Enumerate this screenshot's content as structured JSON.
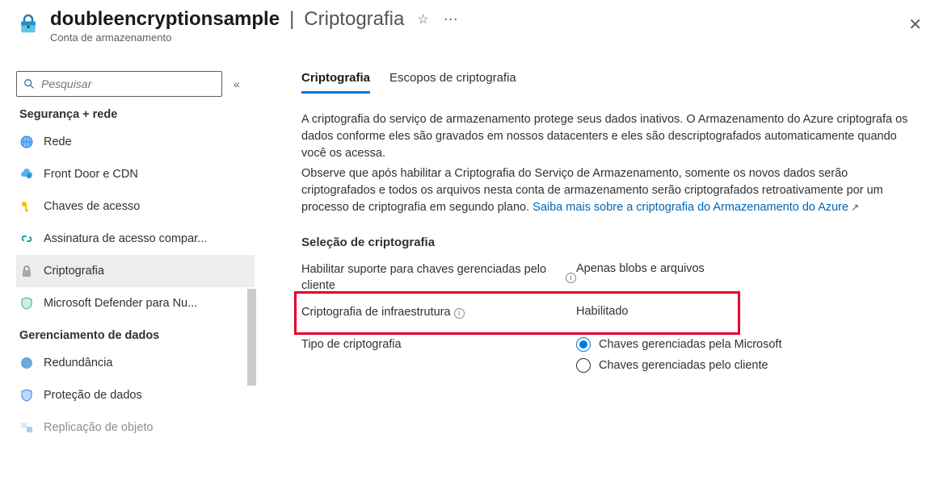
{
  "header": {
    "resource_name": "doubleencryptionsample",
    "separator": "|",
    "blade_name": "Criptografia",
    "subtitle": "Conta de armazenamento"
  },
  "sidebar": {
    "search_placeholder": "Pesquisar",
    "section_security": "Segurança + rede",
    "section_data": "Gerenciamento de dados",
    "items_security": [
      {
        "label": "Rede"
      },
      {
        "label": "Front Door e CDN"
      },
      {
        "label": "Chaves de acesso"
      },
      {
        "label": "Assinatura de acesso compar..."
      },
      {
        "label": "Criptografia",
        "active": true
      },
      {
        "label": "Microsoft Defender para Nu..."
      }
    ],
    "items_data": [
      {
        "label": "Redundância"
      },
      {
        "label": "Proteção de dados"
      },
      {
        "label": "Replicação de objeto"
      }
    ]
  },
  "tabs": [
    {
      "label": "Criptografia",
      "active": true
    },
    {
      "label": "Escopos de criptografia"
    }
  ],
  "content": {
    "para1": "A criptografia do serviço de armazenamento protege seus dados inativos. O Armazenamento do Azure criptografa os dados conforme eles são gravados em nossos datacenters e eles são descriptografados automaticamente quando você os acessa.",
    "para2": "Observe que após habilitar a Criptografia do Serviço de Armazenamento, somente os novos dados serão criptografados e todos os arquivos nesta conta de armazenamento serão criptografados retroativamente por um processo de criptografia em segundo plano. ",
    "link_text": "Saiba mais sobre a criptografia do Armazenamento do Azure",
    "section_heading": "Seleção de criptografia",
    "row_cmk_label": "Habilitar suporte para chaves gerenciadas pelo cliente",
    "row_cmk_value": "Apenas blobs e arquivos",
    "row_infra_label": "Criptografia de infraestrutura",
    "row_infra_value": "Habilitado",
    "row_type_label": "Tipo de criptografia",
    "radio_ms": "Chaves gerenciadas pela Microsoft",
    "radio_customer": "Chaves gerenciadas pelo cliente"
  }
}
